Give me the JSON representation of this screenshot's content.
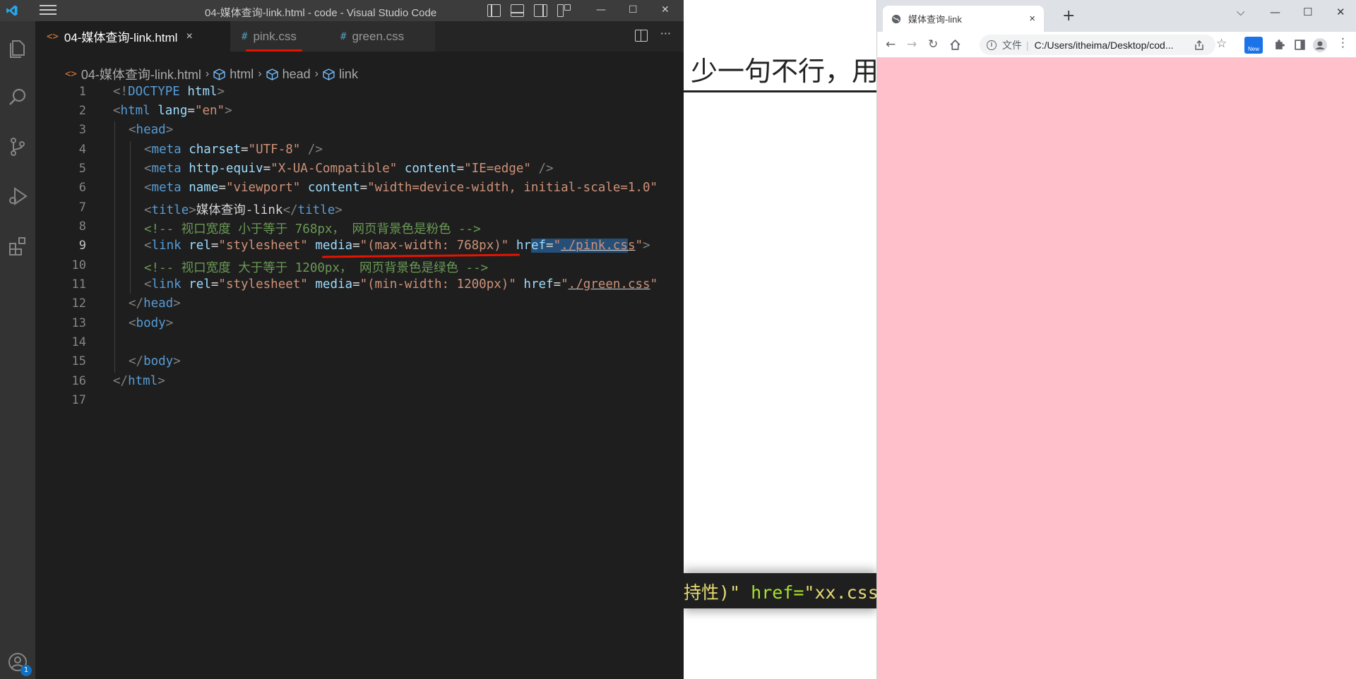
{
  "vscode": {
    "title": "04-媒体查询-link.html - code - Visual Studio Code",
    "tabs": [
      {
        "icon": "<>",
        "label": "04-媒体查询-link.html",
        "close": "×"
      },
      {
        "icon": "#",
        "label": "pink.css"
      },
      {
        "icon": "#",
        "label": "green.css"
      }
    ],
    "more_actions": "···",
    "breadcrumb": [
      "04-媒体查询-link.html",
      "html",
      "head",
      "link"
    ],
    "window_controls": {
      "min": "—",
      "max": "☐",
      "close": "✕"
    },
    "badge": "1",
    "line_numbers": [
      "1",
      "2",
      "3",
      "4",
      "5",
      "6",
      "7",
      "8",
      "9",
      "10",
      "11",
      "12",
      "13",
      "14",
      "15",
      "16",
      "17"
    ],
    "code": {
      "l1": {
        "a": "<!",
        "b": "DOCTYPE",
        "c": " html",
        "d": ">"
      },
      "l2": {
        "a": "<",
        "b": "html",
        "c": " lang",
        "d": "=",
        "e": "\"en\"",
        "f": ">"
      },
      "l3": {
        "a": "<",
        "b": "head",
        "c": ">"
      },
      "l4": {
        "a": "<",
        "b": "meta",
        "c": " charset",
        "d": "=",
        "e": "\"UTF-8\"",
        "f": " />"
      },
      "l5": {
        "a": "<",
        "b": "meta",
        "c": " http-equiv",
        "d": "=",
        "e": "\"X-UA-Compatible\"",
        "f": " content",
        "g": "=",
        "h": "\"IE=edge\"",
        "i": " />"
      },
      "l6": {
        "a": "<",
        "b": "meta",
        "c": " name",
        "d": "=",
        "e": "\"viewport\"",
        "f": " content",
        "g": "=",
        "h": "\"width=device-width, initial-scale=1.0\""
      },
      "l7": {
        "a": "<",
        "b": "title",
        "c": ">",
        "d": "媒体查询-link",
        "e": "</",
        "f": "title",
        "g": ">"
      },
      "l8": "<!-- 视口宽度 小于等于 768px， 网页背景色是粉色 -->",
      "l9": {
        "a": "<",
        "b": "link",
        "c": " rel",
        "d": "=",
        "e": "\"stylesheet\"",
        "f": " media",
        "g": "=",
        "h": "\"(max-width: 768px)\"",
        "i": " hr",
        "j": "ef",
        "k": "=",
        "l": "\"",
        "m": "./pink.cs",
        "n": "s",
        "o": "\"",
        "p": ">"
      },
      "l10": "<!-- 视口宽度 大于等于 1200px， 网页背景色是绿色 -->",
      "l11": {
        "a": "<",
        "b": "link",
        "c": " rel",
        "d": "=",
        "e": "\"stylesheet\"",
        "f": " media",
        "g": "=",
        "h": "\"(min-width: 1200px)\"",
        "i": " href",
        "j": "=",
        "k": "\"",
        "l": "./green.css",
        "m": "\""
      },
      "l12": {
        "a": "</",
        "b": "head",
        "c": ">"
      },
      "l13": {
        "a": "<",
        "b": "body",
        "c": ">"
      },
      "l15": {
        "a": "</",
        "b": "body",
        "c": ">"
      },
      "l16": {
        "a": "</",
        "b": "html",
        "c": ">"
      }
    }
  },
  "slide": {
    "heading": "少一句不行，用",
    "code_a": "持性)\"",
    "code_b": " href=",
    "code_c": "\"xx.css'"
  },
  "chrome": {
    "tab_title": "媒体查询-link",
    "tab_close": "×",
    "new_tab": "+",
    "url_label": "文件",
    "url": "C:/Users/itheima/Desktop/cod...",
    "new_badge": "New",
    "window_controls": {
      "chevron": "⌵",
      "min": "—",
      "max": "☐",
      "close": "✕"
    },
    "page_background": "#ffc0cb"
  }
}
